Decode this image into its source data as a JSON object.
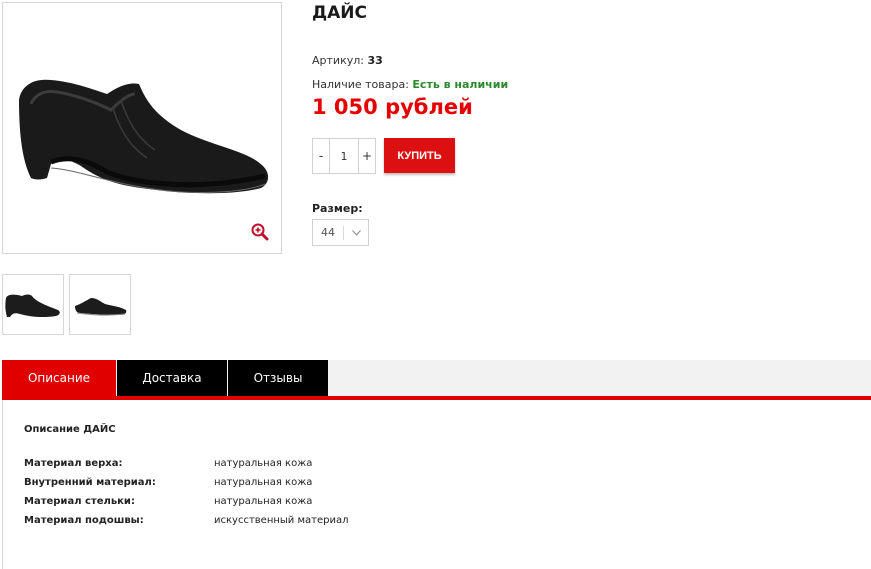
{
  "product": {
    "title": "ДАЙС",
    "article_label": "Артикул:",
    "article_value": "33",
    "availability_label": "Наличие товара:",
    "availability_value": "Есть в наличии",
    "price": "1 050 рублей",
    "quantity": "1",
    "minus_label": "-",
    "plus_label": "+",
    "buy_label": "КУПИТЬ",
    "size_label": "Размер:",
    "size_value": "44"
  },
  "tabs": [
    {
      "label": "Описание",
      "active": true
    },
    {
      "label": "Доставка",
      "active": false
    },
    {
      "label": "Отзывы",
      "active": false
    }
  ],
  "description": {
    "title": "Описание ДАЙС",
    "specs": [
      {
        "name": "Материал верха:",
        "value": "натуральная кожа"
      },
      {
        "name": "Внутренний материал:",
        "value": "натуральная кожа"
      },
      {
        "name": "Материал стельки:",
        "value": "натуральная кожа"
      },
      {
        "name": "Материал подошвы:",
        "value": "искусственный материал"
      }
    ]
  },
  "colors": {
    "accent": "#e00000",
    "price": "#e60000",
    "availability": "#2b8a2b",
    "tab_inactive": "#000000"
  },
  "icons": {
    "zoom": "zoom-in-icon",
    "dropdown": "chevron-down-icon"
  }
}
